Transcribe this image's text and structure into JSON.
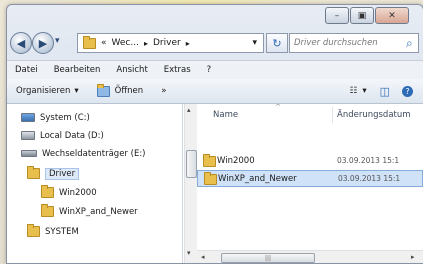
{
  "window": {
    "caption_buttons": [
      {
        "name": "minimize-button",
        "icon": "minimize-icon",
        "glyph": "–"
      },
      {
        "name": "maximize-button",
        "icon": "maximize-icon",
        "glyph": "▣"
      },
      {
        "name": "close-button",
        "icon": "close-icon",
        "glyph": "✕"
      }
    ]
  },
  "address": {
    "back_glyph": "◀",
    "forward_glyph": "▶",
    "history_glyph": "▾",
    "overflow": "«",
    "crumbs": [
      "Wec...",
      "Driver"
    ],
    "separator": "▸",
    "dropdown_glyph": "▾",
    "refresh_glyph": "↻"
  },
  "search": {
    "placeholder": "Driver durchsuchen",
    "icon": "search-icon",
    "glyph": "⌕"
  },
  "menu": [
    "Datei",
    "Bearbeiten",
    "Ansicht",
    "Extras",
    "?"
  ],
  "toolbar": {
    "organize": "Organisieren",
    "organize_arrow": "▾",
    "open": "Öffnen",
    "more": "»",
    "views_glyph": "☷",
    "views_arrow": "▾",
    "preview_glyph": "◫",
    "help_glyph": "?"
  },
  "nav_tree": [
    {
      "label": "System (C:)",
      "icon": "system-drive-icon",
      "type": "drive-sys"
    },
    {
      "label": "Local Data (D:)",
      "icon": "hard-drive-icon",
      "type": "drive"
    },
    {
      "label": "Wechseldatenträger (E:)",
      "icon": "removable-drive-icon",
      "type": "usb"
    },
    {
      "label": "Driver",
      "icon": "folder-icon",
      "type": "folder",
      "selected": true
    },
    {
      "label": "Win2000",
      "icon": "folder-icon",
      "type": "folder"
    },
    {
      "label": "WinXP_and_Newer",
      "icon": "folder-icon",
      "type": "folder"
    },
    {
      "label": "SYSTEM",
      "icon": "folder-icon",
      "type": "folder"
    }
  ],
  "columns": {
    "name": "Name",
    "modified": "Änderungsdatum",
    "sort_glyph": "^"
  },
  "files": [
    {
      "name": "Win2000",
      "date": "03.09.2013 15:1",
      "selected": false
    },
    {
      "name": "WinXP_and_Newer",
      "date": "03.09.2013 15:1",
      "selected": true
    }
  ],
  "scroll": {
    "up": "▴",
    "down": "▾",
    "left": "◂",
    "right": "▸",
    "grip": "|||"
  },
  "colors": {
    "folder": "#e8be4c",
    "selection": "#cfe2f8",
    "accent": "#2e6bb5"
  }
}
